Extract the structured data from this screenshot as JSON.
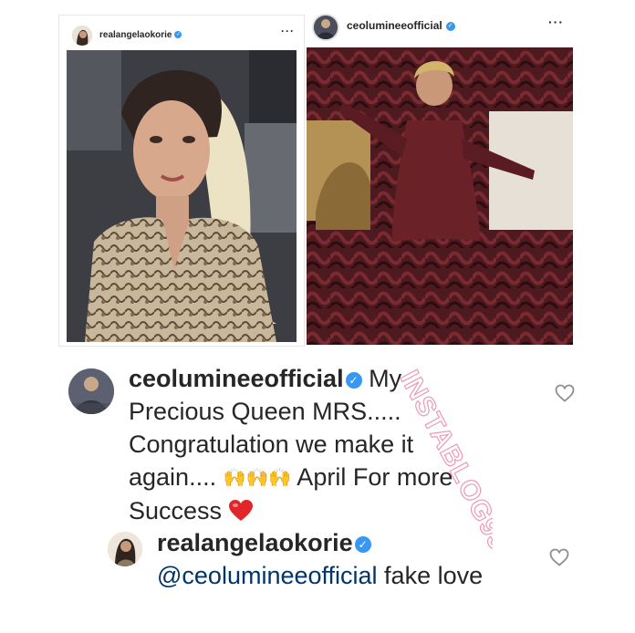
{
  "posts": [
    {
      "username": "realangelaokorie",
      "verified": true,
      "more": "···"
    },
    {
      "username": "ceolumineeofficial",
      "verified": true,
      "more": "···"
    }
  ],
  "comment": {
    "username": "ceolumineeofficial",
    "text_before": " My Precious Queen MRS..... Congratulation we make it again.... ",
    "emoji": "🙌🙌🙌",
    "text_after": " April For more Success "
  },
  "reply": {
    "username": "realangelaokorie",
    "mention": "@ceolumineeofficial",
    "text": " fake love"
  },
  "watermark": "INSTABLOG9JA",
  "colors": {
    "verified": "#3897f0",
    "text": "#262626",
    "mention": "#003569",
    "heart": "#e0262a"
  }
}
